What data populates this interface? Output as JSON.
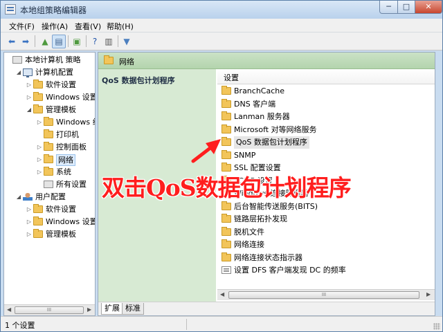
{
  "window": {
    "title": "本地组策略编辑器"
  },
  "title_buttons": {
    "minimize": "─",
    "maximize": "□",
    "close": "✕"
  },
  "menu": [
    {
      "label": "文件(F)"
    },
    {
      "label": "操作(A)"
    },
    {
      "label": "查看(V)"
    },
    {
      "label": "帮助(H)"
    }
  ],
  "toolbar": [
    {
      "icon": "back-arrow-icon",
      "glyph": "⬅",
      "color": "#3a73c2"
    },
    {
      "icon": "forward-arrow-icon",
      "glyph": "➡",
      "color": "#3a73c2"
    },
    {
      "icon": "up-folder-icon",
      "glyph": "▲",
      "color": "#4f9a3f"
    },
    {
      "icon": "show-hide-tree-icon",
      "glyph": "▤",
      "color": "#3d5f8d"
    },
    {
      "icon": "export-list-icon",
      "glyph": "▣",
      "color": "#4f9a3f"
    },
    {
      "icon": "help-icon",
      "glyph": "?",
      "color": "#2255aa"
    },
    {
      "icon": "properties-icon",
      "glyph": "▥",
      "color": "#555555"
    },
    {
      "icon": "filter-icon",
      "glyph": "▼",
      "color": "#4c7fbf"
    }
  ],
  "tree": [
    {
      "label": "本地计算机 策略",
      "level": 0,
      "arrow": "",
      "icon": "settings"
    },
    {
      "label": "计算机配置",
      "level": 1,
      "arrow": "◢",
      "icon": "computer"
    },
    {
      "label": "软件设置",
      "level": 2,
      "arrow": "▷",
      "icon": "folder"
    },
    {
      "label": "Windows 设置",
      "level": 2,
      "arrow": "▷",
      "icon": "folder"
    },
    {
      "label": "管理模板",
      "level": 2,
      "arrow": "◢",
      "icon": "folder"
    },
    {
      "label": "Windows 组件",
      "level": 3,
      "arrow": "▷",
      "icon": "folder"
    },
    {
      "label": "打印机",
      "level": 3,
      "arrow": "",
      "icon": "folder"
    },
    {
      "label": "控制面板",
      "level": 3,
      "arrow": "▷",
      "icon": "folder"
    },
    {
      "label": "网络",
      "level": 3,
      "arrow": "▷",
      "icon": "folder",
      "selected": true
    },
    {
      "label": "系统",
      "level": 3,
      "arrow": "▷",
      "icon": "folder"
    },
    {
      "label": "所有设置",
      "level": 3,
      "arrow": "",
      "icon": "settings"
    },
    {
      "label": "用户配置",
      "level": 1,
      "arrow": "◢",
      "icon": "user"
    },
    {
      "label": "软件设置",
      "level": 2,
      "arrow": "▷",
      "icon": "folder"
    },
    {
      "label": "Windows 设置",
      "level": 2,
      "arrow": "▷",
      "icon": "folder"
    },
    {
      "label": "管理模板",
      "level": 2,
      "arrow": "▷",
      "icon": "folder"
    }
  ],
  "content": {
    "header_title": "网络",
    "description_title": "QoS 数据包计划程序",
    "column_header": "设置",
    "items": [
      {
        "label": "BranchCache",
        "icon": "folder"
      },
      {
        "label": "DNS 客户端",
        "icon": "folder"
      },
      {
        "label": "Lanman 服务器",
        "icon": "folder"
      },
      {
        "label": "Microsoft 对等网络服务",
        "icon": "folder"
      },
      {
        "label": "QoS 数据包计划程序",
        "icon": "folder",
        "selected": true
      },
      {
        "label": "SNMP",
        "icon": "folder"
      },
      {
        "label": "SSL 配置设置",
        "icon": "folder"
      },
      {
        "label": "TCPIP 设置",
        "icon": "folder"
      },
      {
        "label": "Windows 连接管理器",
        "icon": "folder"
      },
      {
        "label": "后台智能传送服务(BITS)",
        "icon": "folder"
      },
      {
        "label": "链路层拓扑发现",
        "icon": "folder"
      },
      {
        "label": "脱机文件",
        "icon": "folder"
      },
      {
        "label": "网络连接",
        "icon": "folder"
      },
      {
        "label": "网络连接状态指示器",
        "icon": "folder"
      },
      {
        "label": "设置 DFS 客户端发现 DC 的频率",
        "icon": "document"
      }
    ]
  },
  "tabs": [
    {
      "label": "扩展"
    },
    {
      "label": "标准"
    }
  ],
  "status": {
    "text": "1 个设置"
  },
  "annotation": {
    "text": "双击QoS数据包计划程序",
    "color": "#ff1e1e"
  }
}
